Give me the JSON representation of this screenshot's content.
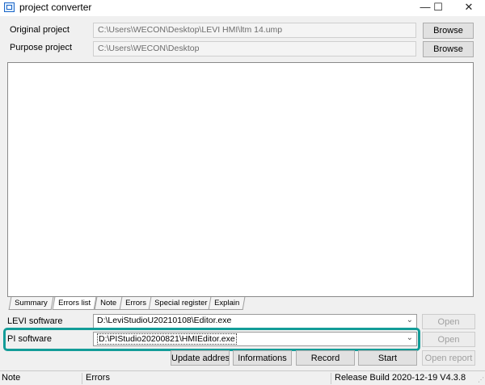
{
  "window": {
    "title": "project converter",
    "minimize_glyph": "—",
    "maximize_glyph": "☐",
    "close_glyph": "✕"
  },
  "original_project": {
    "label": "Original project",
    "value": "C:\\Users\\WECON\\Desktop\\LEVI HMI\\ltm 14.ump",
    "button": "Browse"
  },
  "purpose_project": {
    "label": "Purpose project",
    "value": "C:\\Users\\WECON\\Desktop",
    "button": "Browse"
  },
  "tabs": [
    "Summary",
    "Errors list",
    "Note",
    "Errors",
    "Special register",
    "Explain"
  ],
  "active_tab": "Errors list",
  "levi_software": {
    "label": "LEVI software",
    "value": "D:\\LeviStudioU20210108\\Editor.exe",
    "button": "Open"
  },
  "pi_software": {
    "label": "PI software",
    "value": "D:\\PIStudio20200821\\HMIEditor.exe",
    "button": "Open"
  },
  "actions": {
    "update_address": "Update address",
    "informations": "Informations",
    "record": "Record",
    "start": "Start",
    "open_report": "Open report"
  },
  "status": {
    "note": "Note",
    "errors": "Errors",
    "build": "Release Build 2020-12-19 V4.3.8"
  },
  "colors": {
    "highlight": "#139c98"
  }
}
